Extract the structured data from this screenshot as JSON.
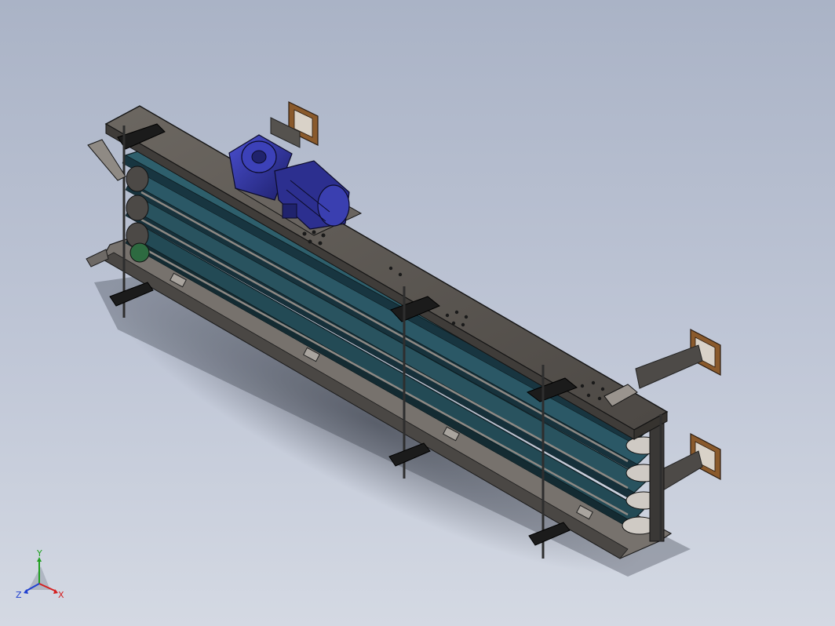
{
  "viewport": {
    "background_top": "#aab3c6",
    "background_bottom": "#d4d9e3"
  },
  "model": {
    "frame_color": "#5e5a56",
    "belt_color": "#234a55",
    "motor_color": "#2c2f8f",
    "bracket_color": "#8a5a2c"
  },
  "triad": {
    "x_label": "X",
    "y_label": "Y",
    "z_label": "Z",
    "x_color": "#d42020",
    "y_color": "#20a020",
    "z_color": "#2040d0"
  }
}
